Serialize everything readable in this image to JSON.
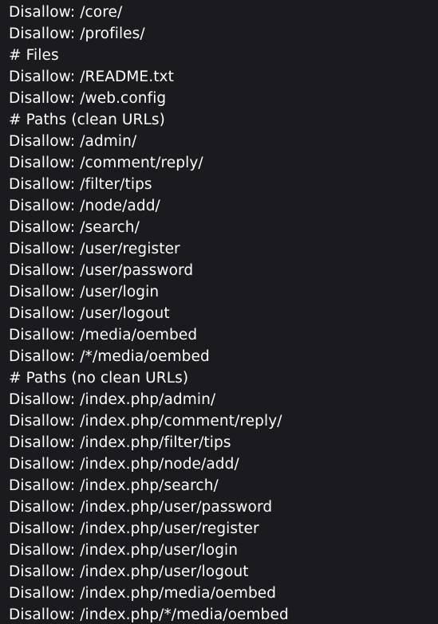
{
  "document": {
    "lines": [
      "Disallow: /core/",
      "Disallow: /profiles/",
      "# Files",
      "Disallow: /README.txt",
      "Disallow: /web.config",
      "# Paths (clean URLs)",
      "Disallow: /admin/",
      "Disallow: /comment/reply/",
      "Disallow: /filter/tips",
      "Disallow: /node/add/",
      "Disallow: /search/",
      "Disallow: /user/register",
      "Disallow: /user/password",
      "Disallow: /user/login",
      "Disallow: /user/logout",
      "Disallow: /media/oembed",
      "Disallow: /*/media/oembed",
      "# Paths (no clean URLs)",
      "Disallow: /index.php/admin/",
      "Disallow: /index.php/comment/reply/",
      "Disallow: /index.php/filter/tips",
      "Disallow: /index.php/node/add/",
      "Disallow: /index.php/search/",
      "Disallow: /index.php/user/password",
      "Disallow: /index.php/user/register",
      "Disallow: /index.php/user/login",
      "Disallow: /index.php/user/logout",
      "Disallow: /index.php/media/oembed",
      "Disallow: /index.php/*/media/oembed"
    ]
  },
  "colors": {
    "background": "#1b1b1f",
    "text": "#ffffff"
  }
}
